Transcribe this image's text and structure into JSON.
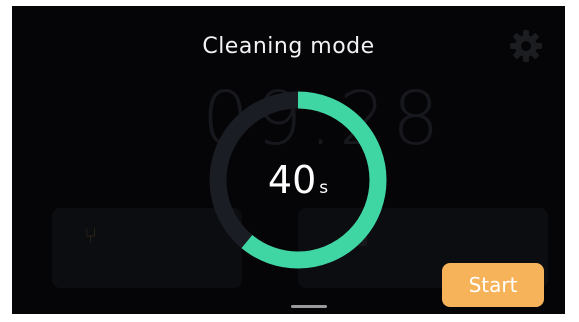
{
  "dialog": {
    "title": "Cleaning mode",
    "timer_value": "40",
    "timer_unit": "s",
    "progress_fraction": 0.61,
    "start_label": "Start"
  },
  "background": {
    "clock": "09:28"
  },
  "icons": {
    "settings": "gear-icon"
  },
  "colors": {
    "progress": "#3fd6a4",
    "track": "#1b1d24",
    "accent_button": "#f7b35a",
    "screen_bg": "#050507"
  }
}
